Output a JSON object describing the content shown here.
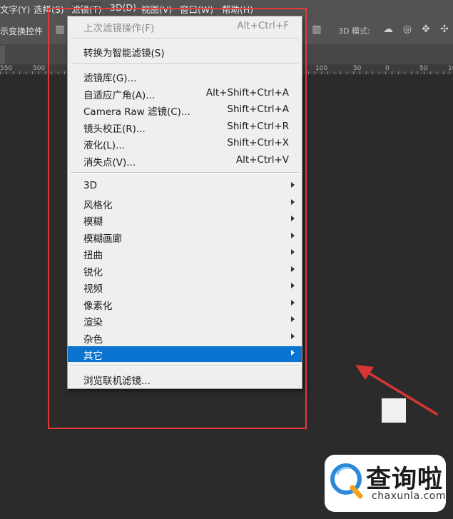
{
  "menubar": {
    "items": [
      "文字(Y)",
      "选择(S)",
      "滤镜(T)",
      "3D(D)",
      "视图(V)",
      "窗口(W)",
      "帮助(H)"
    ]
  },
  "options_bar": {
    "transform_label": "示变换控件",
    "mode_label": "3D 模式:"
  },
  "ruler": {
    "ticks": [
      "550",
      "500",
      "100",
      "50",
      "0",
      "50",
      "100"
    ]
  },
  "filter_menu": {
    "items": [
      {
        "label": "上次滤镜操作(F)",
        "shortcut": "Alt+Ctrl+F",
        "disabled": true
      },
      {
        "label": "转换为智能滤镜(S)",
        "shortcut": ""
      },
      {
        "label": "滤镜库(G)...",
        "shortcut": ""
      },
      {
        "label": "自适应广角(A)...",
        "shortcut": "Alt+Shift+Ctrl+A"
      },
      {
        "label": "Camera Raw 滤镜(C)...",
        "shortcut": "Shift+Ctrl+A"
      },
      {
        "label": "镜头校正(R)...",
        "shortcut": "Shift+Ctrl+R"
      },
      {
        "label": "液化(L)...",
        "shortcut": "Shift+Ctrl+X"
      },
      {
        "label": "消失点(V)...",
        "shortcut": "Alt+Ctrl+V"
      },
      {
        "label": "3D",
        "submenu": true
      },
      {
        "label": "风格化",
        "submenu": true
      },
      {
        "label": "模糊",
        "submenu": true
      },
      {
        "label": "模糊画廊",
        "submenu": true
      },
      {
        "label": "扭曲",
        "submenu": true
      },
      {
        "label": "锐化",
        "submenu": true
      },
      {
        "label": "视频",
        "submenu": true
      },
      {
        "label": "像素化",
        "submenu": true
      },
      {
        "label": "渲染",
        "submenu": true
      },
      {
        "label": "杂色",
        "submenu": true
      },
      {
        "label": "其它",
        "submenu": true,
        "selected": true
      },
      {
        "label": "浏览联机滤镜...",
        "shortcut": ""
      }
    ]
  },
  "watermark": {
    "brand_cn": "查询啦",
    "brand_en": "chaxunla.com"
  },
  "colors": {
    "highlight": "#e23b3b",
    "selection": "#0b74d1",
    "menu_bg": "#efefef",
    "workspace": "#2b2b2b"
  }
}
